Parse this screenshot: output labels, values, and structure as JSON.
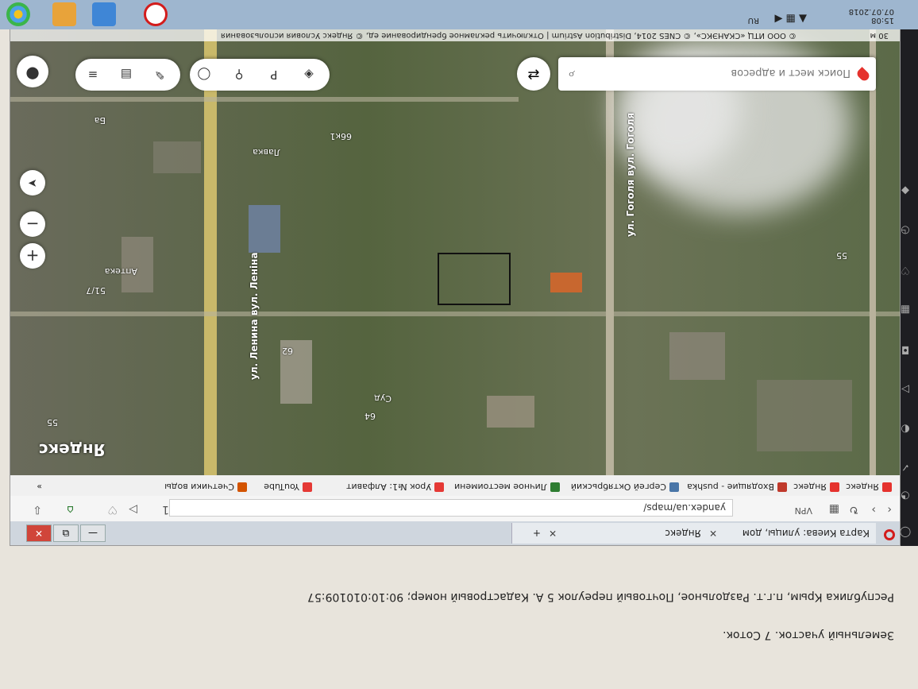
{
  "caption": {
    "line1": "Земельный участок. 7 Соток.",
    "line2": "Республика Крым, п.г.т. Раздольное, Почтовый переулок 5 А. Кадастровый номер; 90:10:010109:57"
  },
  "tabs": [
    {
      "label": "Карта Киева: улицы, дом",
      "close": "✕"
    },
    {
      "label": "Яндекс",
      "close": "✕"
    }
  ],
  "window_buttons": {
    "minimize": "—",
    "restore": "⧉",
    "close": "✕",
    "new_tab": "+"
  },
  "address": {
    "url": "yandex.ua/maps/",
    "badge": "1"
  },
  "bookmarks": [
    {
      "label": "Яндекс",
      "color": "#e5322d"
    },
    {
      "label": "Яндекс",
      "color": "#e5322d"
    },
    {
      "label": "Входящие - pushka",
      "color": "#c0392b"
    },
    {
      "label": "Сергей Октябрьский",
      "color": "#4a76a8"
    },
    {
      "label": "Личное местоимени",
      "color": "#2e7d32"
    },
    {
      "label": "Урок №1: Алфавит",
      "color": "#e53935"
    },
    {
      "label": "YouTube",
      "color": "#e53935"
    },
    {
      "label": "Счетчики воды",
      "color": "#d35400"
    }
  ],
  "bookmarks_more": "»",
  "map": {
    "search_placeholder": "Поиск мест и адресов",
    "logo": "Яндекс",
    "attribution": "© ООО ИТЦ «СКАНЭКС», © CNES 2014, Distribution Astrium | Отключить рекламное брендирование ед, © Яндекс Условия использования",
    "scale": "30 м",
    "zoom_in": "+",
    "zoom_out": "−",
    "streets": [
      "ул. Ленина вул. Леніна",
      "ул. Гоголя вул. Гоголя"
    ],
    "house_numbers": [
      "62",
      "51/7",
      "64",
      "55",
      "66к1",
      "55"
    ],
    "pois": [
      "Суд",
      "Аптека",
      "Лавка",
      "Ба"
    ]
  },
  "taskbar": {
    "lang": "RU",
    "time": "15:08",
    "date": "07.07.2018"
  }
}
